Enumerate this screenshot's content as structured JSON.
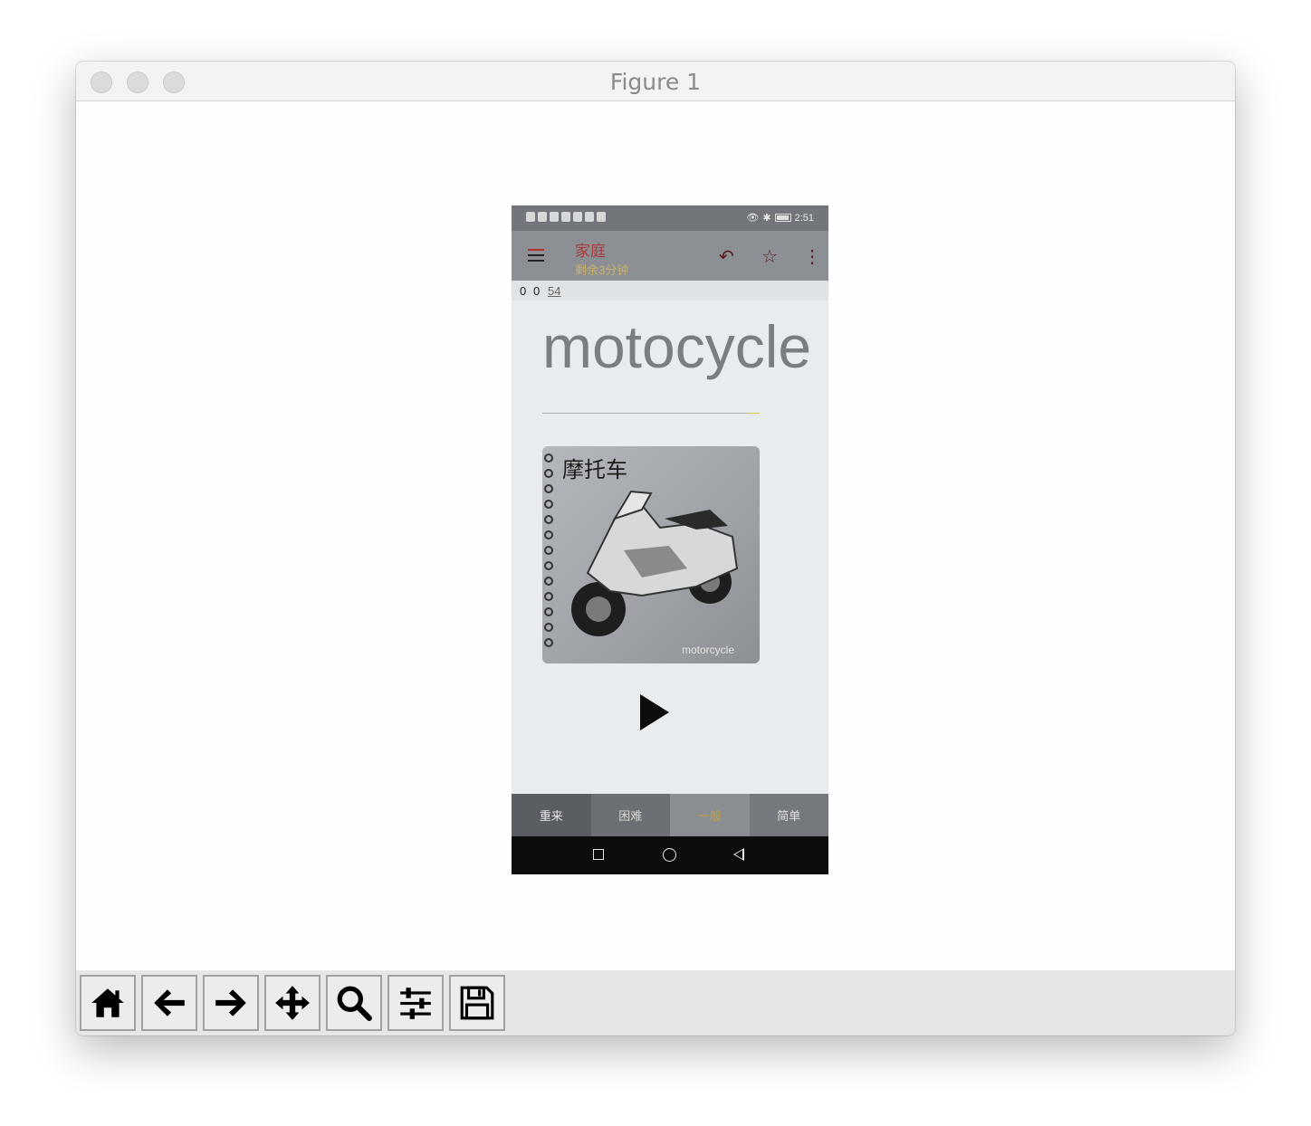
{
  "window": {
    "title": "Figure 1"
  },
  "phone": {
    "status_bar": {
      "time": "2:51"
    },
    "app_bar": {
      "title": "家庭",
      "subtitle": "剩余3分钟"
    },
    "counter": {
      "correct": "0",
      "wrong": "0",
      "total": "54"
    },
    "word": "motocycle",
    "card": {
      "chinese": "摩托车",
      "english": "motorcycle"
    },
    "bottom_tabs": [
      {
        "label": "重来",
        "bg": "#5a5e62",
        "fg": "#e6e6e6"
      },
      {
        "label": "困难",
        "bg": "#6c6f73",
        "fg": "#d8d8d8"
      },
      {
        "label": "一般",
        "bg": "#8a8d91",
        "fg": "#c9a240"
      },
      {
        "label": "简单",
        "bg": "#75787c",
        "fg": "#e0e0e0"
      }
    ]
  },
  "toolbar": {
    "buttons": [
      "home-icon",
      "back-arrow-icon",
      "forward-arrow-icon",
      "pan-icon",
      "zoom-icon",
      "sliders-icon",
      "save-icon"
    ]
  }
}
